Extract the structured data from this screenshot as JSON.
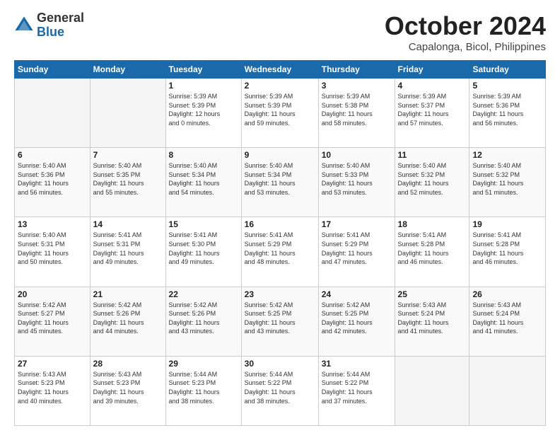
{
  "header": {
    "logo_general": "General",
    "logo_blue": "Blue",
    "month": "October 2024",
    "location": "Capalonga, Bicol, Philippines"
  },
  "weekdays": [
    "Sunday",
    "Monday",
    "Tuesday",
    "Wednesday",
    "Thursday",
    "Friday",
    "Saturday"
  ],
  "weeks": [
    [
      {
        "day": "",
        "info": ""
      },
      {
        "day": "",
        "info": ""
      },
      {
        "day": "1",
        "info": "Sunrise: 5:39 AM\nSunset: 5:39 PM\nDaylight: 12 hours\nand 0 minutes."
      },
      {
        "day": "2",
        "info": "Sunrise: 5:39 AM\nSunset: 5:39 PM\nDaylight: 11 hours\nand 59 minutes."
      },
      {
        "day": "3",
        "info": "Sunrise: 5:39 AM\nSunset: 5:38 PM\nDaylight: 11 hours\nand 58 minutes."
      },
      {
        "day": "4",
        "info": "Sunrise: 5:39 AM\nSunset: 5:37 PM\nDaylight: 11 hours\nand 57 minutes."
      },
      {
        "day": "5",
        "info": "Sunrise: 5:39 AM\nSunset: 5:36 PM\nDaylight: 11 hours\nand 56 minutes."
      }
    ],
    [
      {
        "day": "6",
        "info": "Sunrise: 5:40 AM\nSunset: 5:36 PM\nDaylight: 11 hours\nand 56 minutes."
      },
      {
        "day": "7",
        "info": "Sunrise: 5:40 AM\nSunset: 5:35 PM\nDaylight: 11 hours\nand 55 minutes."
      },
      {
        "day": "8",
        "info": "Sunrise: 5:40 AM\nSunset: 5:34 PM\nDaylight: 11 hours\nand 54 minutes."
      },
      {
        "day": "9",
        "info": "Sunrise: 5:40 AM\nSunset: 5:34 PM\nDaylight: 11 hours\nand 53 minutes."
      },
      {
        "day": "10",
        "info": "Sunrise: 5:40 AM\nSunset: 5:33 PM\nDaylight: 11 hours\nand 53 minutes."
      },
      {
        "day": "11",
        "info": "Sunrise: 5:40 AM\nSunset: 5:32 PM\nDaylight: 11 hours\nand 52 minutes."
      },
      {
        "day": "12",
        "info": "Sunrise: 5:40 AM\nSunset: 5:32 PM\nDaylight: 11 hours\nand 51 minutes."
      }
    ],
    [
      {
        "day": "13",
        "info": "Sunrise: 5:40 AM\nSunset: 5:31 PM\nDaylight: 11 hours\nand 50 minutes."
      },
      {
        "day": "14",
        "info": "Sunrise: 5:41 AM\nSunset: 5:31 PM\nDaylight: 11 hours\nand 49 minutes."
      },
      {
        "day": "15",
        "info": "Sunrise: 5:41 AM\nSunset: 5:30 PM\nDaylight: 11 hours\nand 49 minutes."
      },
      {
        "day": "16",
        "info": "Sunrise: 5:41 AM\nSunset: 5:29 PM\nDaylight: 11 hours\nand 48 minutes."
      },
      {
        "day": "17",
        "info": "Sunrise: 5:41 AM\nSunset: 5:29 PM\nDaylight: 11 hours\nand 47 minutes."
      },
      {
        "day": "18",
        "info": "Sunrise: 5:41 AM\nSunset: 5:28 PM\nDaylight: 11 hours\nand 46 minutes."
      },
      {
        "day": "19",
        "info": "Sunrise: 5:41 AM\nSunset: 5:28 PM\nDaylight: 11 hours\nand 46 minutes."
      }
    ],
    [
      {
        "day": "20",
        "info": "Sunrise: 5:42 AM\nSunset: 5:27 PM\nDaylight: 11 hours\nand 45 minutes."
      },
      {
        "day": "21",
        "info": "Sunrise: 5:42 AM\nSunset: 5:26 PM\nDaylight: 11 hours\nand 44 minutes."
      },
      {
        "day": "22",
        "info": "Sunrise: 5:42 AM\nSunset: 5:26 PM\nDaylight: 11 hours\nand 43 minutes."
      },
      {
        "day": "23",
        "info": "Sunrise: 5:42 AM\nSunset: 5:25 PM\nDaylight: 11 hours\nand 43 minutes."
      },
      {
        "day": "24",
        "info": "Sunrise: 5:42 AM\nSunset: 5:25 PM\nDaylight: 11 hours\nand 42 minutes."
      },
      {
        "day": "25",
        "info": "Sunrise: 5:43 AM\nSunset: 5:24 PM\nDaylight: 11 hours\nand 41 minutes."
      },
      {
        "day": "26",
        "info": "Sunrise: 5:43 AM\nSunset: 5:24 PM\nDaylight: 11 hours\nand 41 minutes."
      }
    ],
    [
      {
        "day": "27",
        "info": "Sunrise: 5:43 AM\nSunset: 5:23 PM\nDaylight: 11 hours\nand 40 minutes."
      },
      {
        "day": "28",
        "info": "Sunrise: 5:43 AM\nSunset: 5:23 PM\nDaylight: 11 hours\nand 39 minutes."
      },
      {
        "day": "29",
        "info": "Sunrise: 5:44 AM\nSunset: 5:23 PM\nDaylight: 11 hours\nand 38 minutes."
      },
      {
        "day": "30",
        "info": "Sunrise: 5:44 AM\nSunset: 5:22 PM\nDaylight: 11 hours\nand 38 minutes."
      },
      {
        "day": "31",
        "info": "Sunrise: 5:44 AM\nSunset: 5:22 PM\nDaylight: 11 hours\nand 37 minutes."
      },
      {
        "day": "",
        "info": ""
      },
      {
        "day": "",
        "info": ""
      }
    ]
  ]
}
